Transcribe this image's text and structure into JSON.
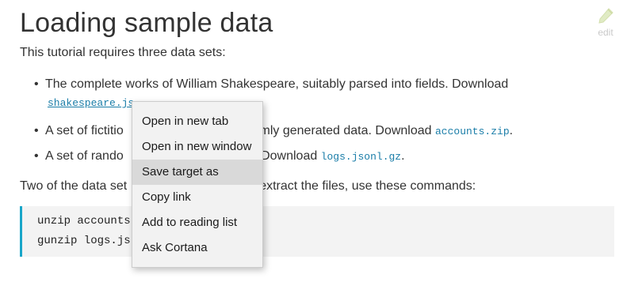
{
  "page": {
    "title": "Loading sample data",
    "edit_label": "edit",
    "intro": "This tutorial requires three data sets:"
  },
  "bullets": [
    {
      "text": "The complete works of William Shakespeare, suitably parsed into fields. Download",
      "link": "shakespeare.js"
    },
    {
      "text_before": "A set of fictitio",
      "text_after": "omly generated data. Download",
      "link": "accounts.zip",
      "trailing": "."
    },
    {
      "text_before": "A set of rando",
      "text_after": ". Download",
      "link": "logs.jsonl.gz",
      "trailing": "."
    }
  ],
  "paragraph2": {
    "before": "Two of the data set",
    "after": "extract the files, use these commands:"
  },
  "code_block": {
    "line1": "unzip accounts",
    "line2": "gunzip logs.js"
  },
  "context_menu": {
    "items": [
      "Open in new tab",
      "Open in new window",
      "Save target as",
      "Copy link",
      "Add to reading list",
      "Ask Cortana"
    ],
    "highlighted": "Save target as"
  },
  "colors": {
    "link": "#1a7da8",
    "code_border": "#19a6c9",
    "code_bg": "#f3f3f3",
    "menu_bg": "#f2f2f2",
    "menu_highlight": "#d9d9d9"
  },
  "icons": {
    "edit": "pencil-icon"
  }
}
